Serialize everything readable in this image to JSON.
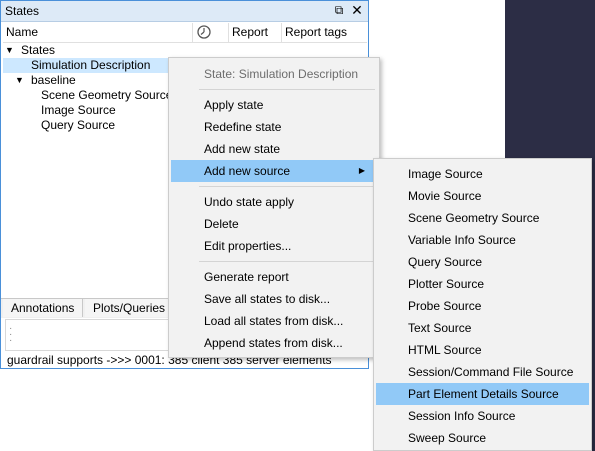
{
  "panel": {
    "title": "States",
    "float_icon": "⧉",
    "close_icon": "✕",
    "columns": {
      "name": "Name",
      "report": "Report",
      "report_tags": "Report tags"
    },
    "tree": {
      "root": "States",
      "item_simulation": "Simulation Description",
      "item_baseline": "baseline",
      "item_scene": "Scene Geometry Source",
      "item_image": "Image Source",
      "item_query": "Query Source"
    },
    "tabs": [
      "Annotations",
      "Plots/Queries"
    ],
    "status": "guardrail supports ->>> 0001: 385 client 385 server elements"
  },
  "context_menu": {
    "header": "State: Simulation Description",
    "items": [
      "Apply state",
      "Redefine state",
      "Add new state",
      "Add new source",
      "Undo state apply",
      "Delete",
      "Edit properties...",
      "Generate report",
      "Save all states to disk...",
      "Load all states from disk...",
      "Append states from disk..."
    ],
    "submenu_arrow": "▶"
  },
  "submenu": {
    "items": [
      "Image Source",
      "Movie Source",
      "Scene Geometry Source",
      "Variable Info Source",
      "Query Source",
      "Plotter Source",
      "Probe Source",
      "Text Source",
      "HTML Source",
      "Session/Command File Source",
      "Part Element Details Source",
      "Session Info Source",
      "Sweep Source"
    ]
  },
  "colors": {
    "selection": "#cde8ff",
    "menu_highlight": "#91c9f7",
    "titlebar": "#ddeaf7",
    "background_dark": "#2c2d45"
  }
}
